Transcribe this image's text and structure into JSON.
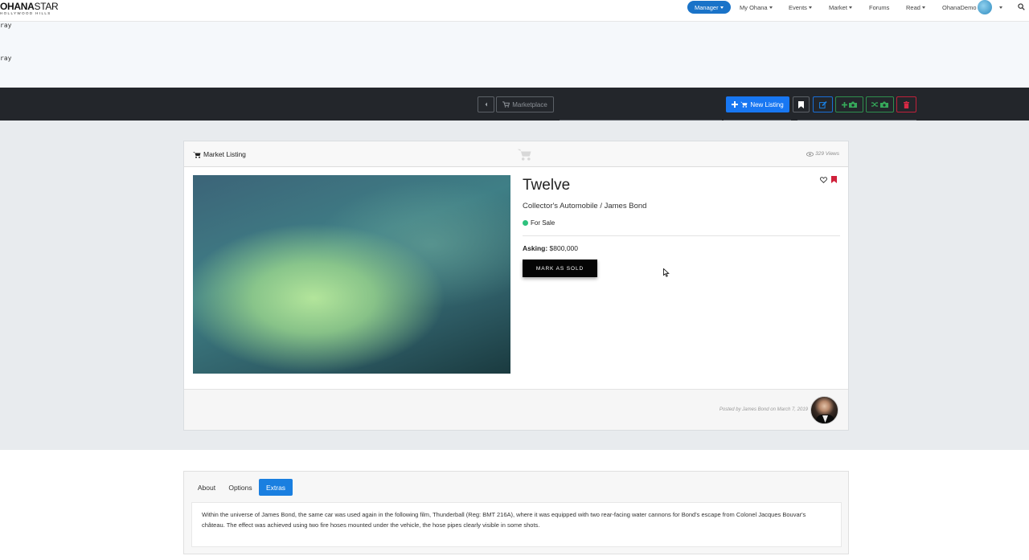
{
  "nav": {
    "logo_bold": "OHANA",
    "logo_thin": "STAR",
    "logo_sub": "HOLLYWOOD HILLS",
    "manager": "Manager",
    "my_ohana": "My Ohana",
    "events": "Events",
    "market": "Market",
    "forums": "Forums",
    "read": "Read",
    "user": "OhanaDemo"
  },
  "band": {
    "line1": "ray",
    "line2": "ray"
  },
  "toolbar": {
    "marketplace_label": "Marketplace",
    "new_listing_label": "New Listing"
  },
  "card": {
    "header_title": "Market Listing",
    "views": "329 Views",
    "title": "Twelve",
    "subtitle": "Collector's Automobile / James Bond",
    "status": "For Sale",
    "asking_label": "Asking:",
    "asking_value": "$800,000",
    "mark_sold_label": "MARK AS SOLD",
    "posted": "Posted by James Bond on March 7, 2019"
  },
  "tabs": {
    "items": [
      "About",
      "Options",
      "Extras"
    ],
    "active": "Extras",
    "extras_text": "Within the universe of James Bond, the same car was used again in the following film, Thunderball (Reg: BMT 216A), where it was equipped with two rear-facing water cannons for Bond's escape from Colonel Jacques Bouvar's château. The effect was achieved using two fire hoses mounted under the vehicle, the hose pipes clearly visible in some shots."
  },
  "colors": {
    "primary": "#1877f2",
    "toolbar_bg": "#23262b",
    "success": "#2ec27e",
    "danger": "#c0213b",
    "section_bg": "#e8ebee"
  }
}
